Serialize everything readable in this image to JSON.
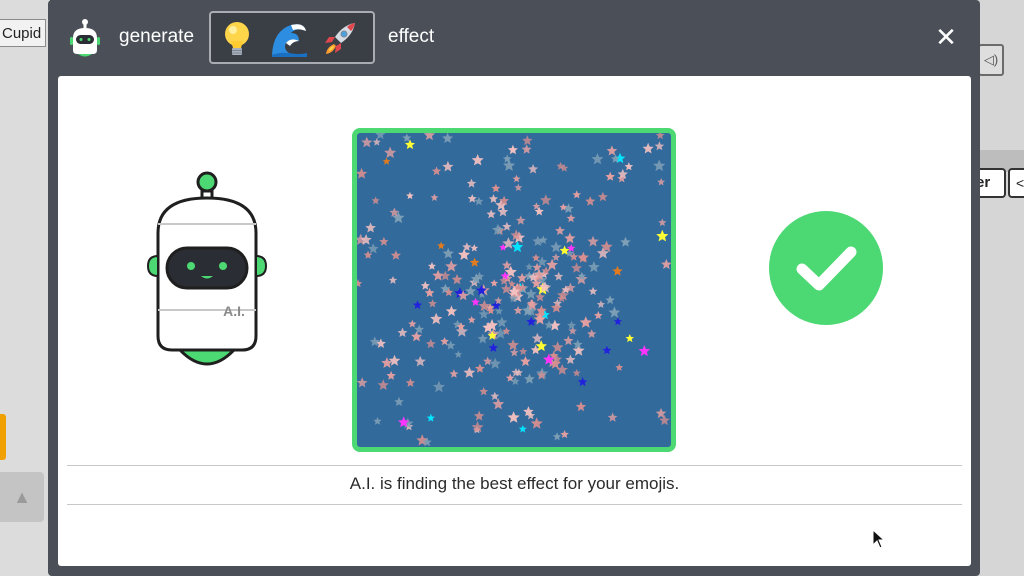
{
  "background": {
    "tab_label": "Cupid",
    "button_partial_label": "er",
    "button_partial_label_2": "<"
  },
  "modal": {
    "header": {
      "word_left": "generate",
      "word_right": "effect",
      "emojis": [
        {
          "icon": "light-bulb-icon",
          "glyph": "💡"
        },
        {
          "icon": "wave-icon",
          "glyph": "🌊"
        },
        {
          "icon": "rocket-icon",
          "glyph": "🚀"
        }
      ],
      "close_glyph": "✕"
    },
    "robot_badge": "A.I.",
    "status_message": "A.I. is finding the best effect for your emojis.",
    "colors": {
      "accent_green": "#4cd873",
      "effect_background": "#336a9c",
      "header_background": "#4b5058"
    },
    "effect_preview": {
      "type": "star-particles",
      "star_colors": [
        "#e8a1a1",
        "#f2c0c0",
        "#d98f8f",
        "#7fa0b6",
        "#ffff33",
        "#00e5ff",
        "#ff33ff",
        "#2222dd",
        "#e07b20"
      ]
    }
  }
}
